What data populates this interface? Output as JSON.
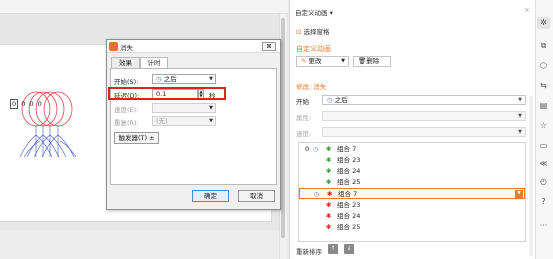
{
  "dialog": {
    "title": "消失",
    "close_label": "⊠",
    "tabs": [
      "效果",
      "计时"
    ],
    "start_label": "开始(S):",
    "start_value": "之后",
    "delay_label": "延迟(D):",
    "delay_value": "0.1",
    "delay_unit": "秒",
    "speed_label": "速度(E):",
    "repeat_label": "重复(R):",
    "repeat_value": "(无)",
    "trigger_label": "触发器(T) ±",
    "ok_label": "确定",
    "cancel_label": "取消"
  },
  "slide": {
    "order_tags": [
      "0",
      "0",
      "0",
      "0"
    ]
  },
  "pane": {
    "title": "自定义动画",
    "title_caret": "▾",
    "close_label": "×",
    "select_pane_label": "选择窗格",
    "section_title": "自定义动画",
    "change_label": "更改",
    "delete_label": "删除",
    "modify_label": "修改: 消失",
    "start_label": "开始",
    "start_value": "之后",
    "property_label": "属性:",
    "speed_label": "速度:",
    "items": [
      {
        "num": "0",
        "mouse": true,
        "effect": "entrance",
        "label": "组合 7",
        "selected": false
      },
      {
        "num": "",
        "mouse": false,
        "effect": "entrance",
        "label": "组合 23",
        "selected": false
      },
      {
        "num": "",
        "mouse": false,
        "effect": "entrance",
        "label": "组合 24",
        "selected": false
      },
      {
        "num": "",
        "mouse": false,
        "effect": "entrance",
        "label": "组合 25",
        "selected": false
      },
      {
        "num": "",
        "mouse": true,
        "effect": "exit",
        "label": "组合 7",
        "selected": true
      },
      {
        "num": "",
        "mouse": false,
        "effect": "exit",
        "label": "组合 23",
        "selected": false
      },
      {
        "num": "",
        "mouse": false,
        "effect": "exit",
        "label": "组合 24",
        "selected": false
      },
      {
        "num": "",
        "mouse": false,
        "effect": "exit",
        "label": "组合 25",
        "selected": false
      }
    ],
    "reorder_label": "重新排序"
  },
  "colors": {
    "accent": "#e87a2c",
    "highlight_box": "#d9261c",
    "entrance_star": "#3a9a3a",
    "exit_star": "#d9261c"
  },
  "sidebar_icons": [
    "animation-icon",
    "layers-icon",
    "shape-icon",
    "transition-icon",
    "template-icon",
    "star-icon",
    "bookmark-icon",
    "share-icon",
    "history-icon",
    "help-icon",
    "more-icon"
  ]
}
